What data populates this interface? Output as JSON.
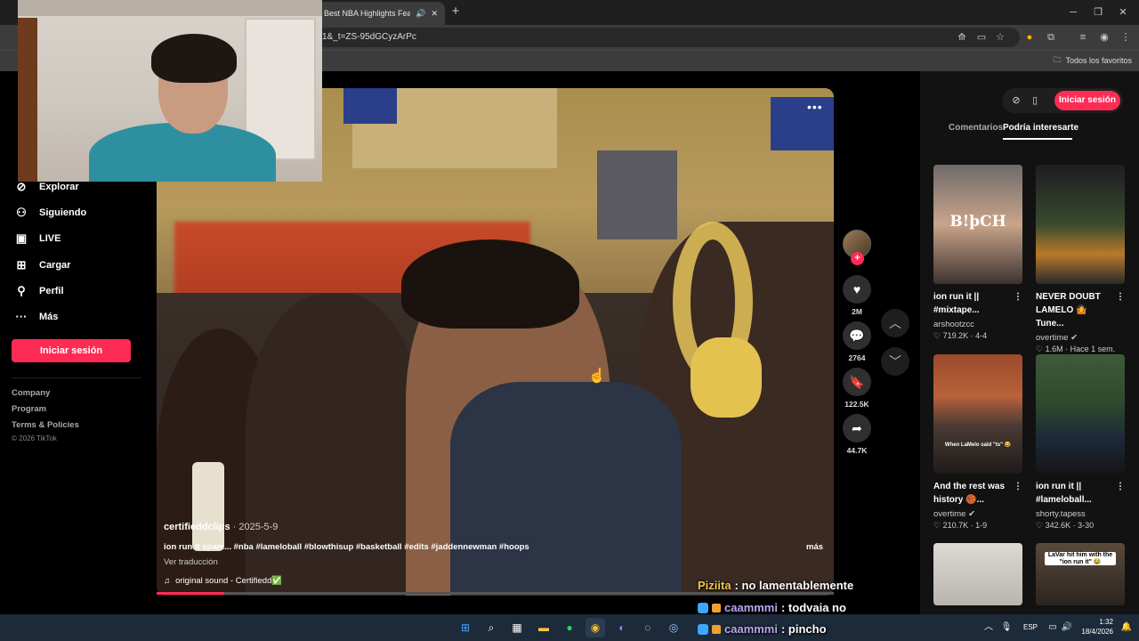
{
  "browser": {
    "tab_title": "Best NBA Highlights Featu",
    "url": "1&_t=ZS-95dGCyzArPc",
    "bookmarks_label": "Todos los favoritos",
    "new_tab": "+",
    "tab_close": "✕"
  },
  "sidebar": {
    "items": [
      {
        "label": "Explorar",
        "icon": "compass-icon",
        "glyph": "⊘"
      },
      {
        "label": "Siguiendo",
        "icon": "user-follow-icon",
        "glyph": "⚇"
      },
      {
        "label": "LIVE",
        "icon": "live-tv-icon",
        "glyph": "▣"
      },
      {
        "label": "Cargar",
        "icon": "upload-icon",
        "glyph": "⊞"
      },
      {
        "label": "Perfil",
        "icon": "profile-icon",
        "glyph": "⚲"
      },
      {
        "label": "Más",
        "icon": "more-icon",
        "glyph": "···"
      }
    ],
    "login_label": "Iniciar sesión",
    "footer_links": [
      "Company",
      "Program",
      "Terms & Policies"
    ],
    "copyright": "© 2026 TikTok"
  },
  "video": {
    "author": "certifieddclips",
    "date": " · 2025-5-9",
    "caption": "ion run it spam... #nba #lameloball #blowthisup #basketball #edits #jaddennewman #hoops",
    "translate": "Ver traducción",
    "more": "más",
    "sound_icon": "♫",
    "sound": "original sound - Certifiedd✅",
    "progress": 0.1,
    "stats": {
      "likes": "2M",
      "comments": "2764",
      "saves": "122.5K",
      "shares": "44.7K"
    }
  },
  "right_panel": {
    "login_label": "Iniciar sesión",
    "tabs": [
      "Comentarios",
      "Podría interesarte"
    ],
    "cards": [
      {
        "title": "ion run it ||\n#mixtape...",
        "author": "arshootzcc",
        "views": "♡ 719.2K",
        "date": "· 4-4",
        "thumb_text": "B!þCH"
      },
      {
        "title": "NEVER DOUBT\nLAMELO 🤷 Tune...",
        "author": "overtime ✔",
        "views": "♡ 1.6M",
        "date": "· Hace 1 sem.",
        "thumb_text": ""
      },
      {
        "title": "And the rest was\nhistory 🏀...",
        "author": "overtime ✔",
        "views": "♡ 210.7K",
        "date": "· 1-9",
        "thumb_text": "When LaMelo said \"ts\" 😂"
      },
      {
        "title": "ion run it ||\n#lameloball...",
        "author": "shorty.tapess",
        "views": "♡ 342.6K",
        "date": "· 3-30",
        "thumb_text": ""
      },
      {
        "title": "",
        "author": "",
        "views": "",
        "date": "",
        "thumb_text": ""
      },
      {
        "title": "",
        "author": "",
        "views": "",
        "date": "",
        "thumb_text": "LaVar hit him with the\n\"ion run it\" 😂"
      }
    ]
  },
  "chat": [
    {
      "user": "Piziita",
      "message": ": no lamentablemente"
    },
    {
      "user": "caammmi",
      "message": ": todvaia no"
    },
    {
      "user": "caammmi",
      "message": ": pincho"
    }
  ],
  "taskbar": {
    "lang": "ESP",
    "time": "1:32",
    "date": "18/4/2026"
  }
}
